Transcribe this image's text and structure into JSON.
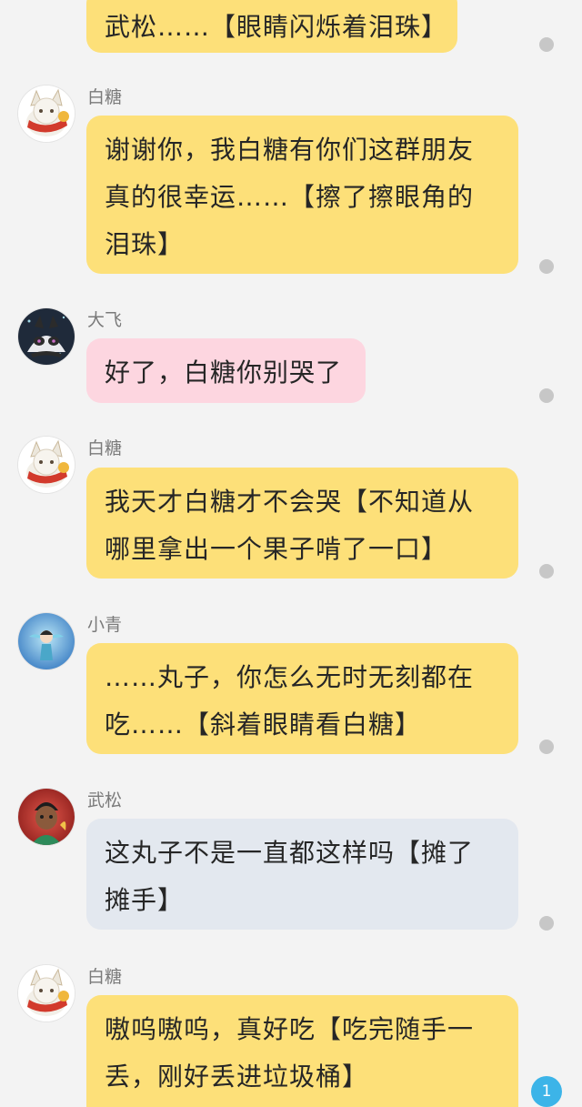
{
  "messages": [
    {
      "sender": "",
      "text": "武松……【眼睛闪烁着泪珠】",
      "avatar": "baitang-avatar",
      "color": "#fde079"
    },
    {
      "sender": "白糖",
      "text": "谢谢你，我白糖有你们这群朋友真的很幸运……【擦了擦眼角的泪珠】",
      "avatar": "baitang-avatar",
      "color": "#fde079"
    },
    {
      "sender": "大飞",
      "text": "好了，白糖你别哭了",
      "avatar": "dafei-avatar",
      "color": "#fdd6e0"
    },
    {
      "sender": "白糖",
      "text": "我天才白糖才不会哭【不知道从哪里拿出一个果子啃了一口】",
      "avatar": "baitang-avatar",
      "color": "#fde079"
    },
    {
      "sender": "小青",
      "text": "……丸子，你怎么无时无刻都在吃……【斜着眼睛看白糖】",
      "avatar": "xiaoqing-avatar",
      "color": "#fde079"
    },
    {
      "sender": "武松",
      "text": "这丸子不是一直都这样吗【摊了摊手】",
      "avatar": "wusong-avatar",
      "color": "#e3e8ef"
    },
    {
      "sender": "白糖",
      "text": "嗷呜嗷呜，真好吃【吃完随手一丢，刚好丢进垃圾桶】",
      "avatar": "baitang-avatar",
      "color": "#fde079"
    }
  ],
  "unread_badge": "1",
  "colors": {
    "background": "#f3f3f3",
    "yellow_bubble": "#fde079",
    "pink_bubble": "#fdd6e0",
    "blue_bubble": "#e3e8ef",
    "badge": "#3cb4e8"
  }
}
